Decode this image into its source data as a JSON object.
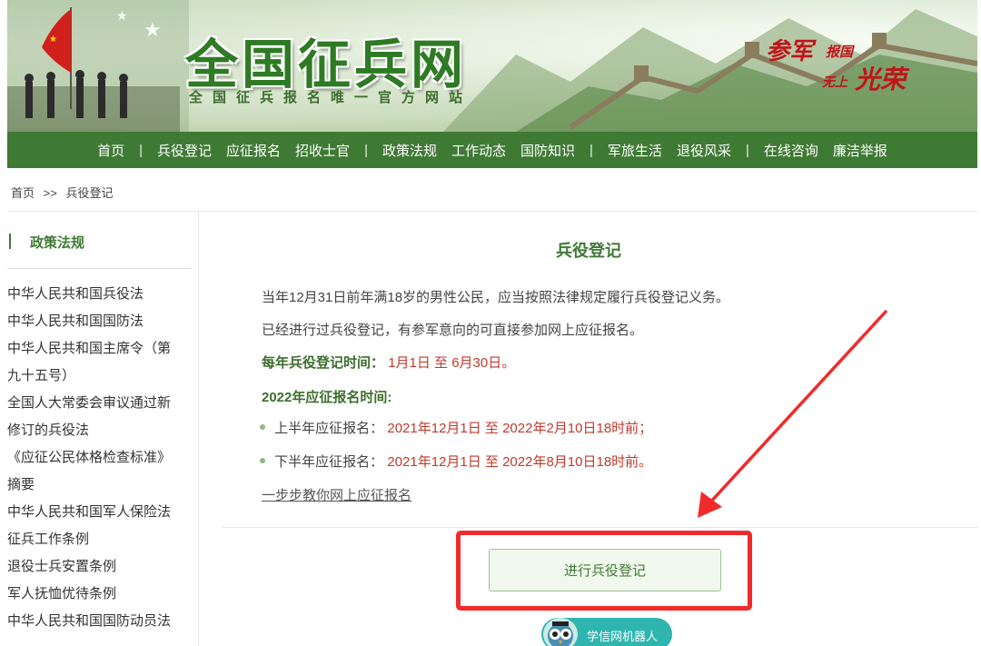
{
  "header": {
    "site_title": "全国征兵网",
    "site_subtitle": "全国征兵报名唯一官方网站",
    "slogan": {
      "part1": "参军",
      "part2": "报国",
      "part3": "无上",
      "part4": "光荣"
    }
  },
  "nav": {
    "items": [
      "首页",
      "兵役登记",
      "应征报名",
      "招收士官",
      "政策法规",
      "工作动态",
      "国防知识",
      "军旅生活",
      "退役风采",
      "在线咨询",
      "廉洁举报"
    ],
    "separator": "|"
  },
  "breadcrumb": {
    "home": "首页",
    "arrow": ">>",
    "current": "兵役登记"
  },
  "sidebar": {
    "heading": "政策法规",
    "links": [
      "中华人民共和国兵役法",
      "中华人民共和国国防法",
      "中华人民共和国主席令（第",
      "九十五号）",
      "全国人大常委会审议通过新",
      "修订的兵役法",
      "《应征公民体格检查标准》",
      "摘要",
      "中华人民共和国军人保险法",
      "征兵工作条例",
      "退役士兵安置条例",
      "军人抚恤优待条例",
      "中华人民共和国国防动员法"
    ]
  },
  "main": {
    "title": "兵役登记",
    "para1": "当年12月31日前年满18岁的男性公民，应当按照法律规定履行兵役登记义务。",
    "para2": "已经进行过兵役登记，有参军意向的可直接参加网上应征报名。",
    "reg_time_label": "每年兵役登记时间：",
    "reg_time_value": "1月1日 至 6月30日。",
    "apply_time_label": "2022年应征报名时间:",
    "first_half_label": "上半年应征报名：",
    "first_half_value": "2021年12月1日 至 2022年2月10日18时前；",
    "second_half_label": "下半年应征报名：",
    "second_half_value": "2021年12月1日 至 2022年8月10日18时前。",
    "guide_link": "一步步教你网上应征报名",
    "register_button": "进行兵役登记"
  },
  "robot": {
    "label": "学信网机器人"
  },
  "colors": {
    "brand_green": "#3f7a34",
    "accent_red": "#c0392b",
    "highlight_red": "#f12b2b"
  }
}
